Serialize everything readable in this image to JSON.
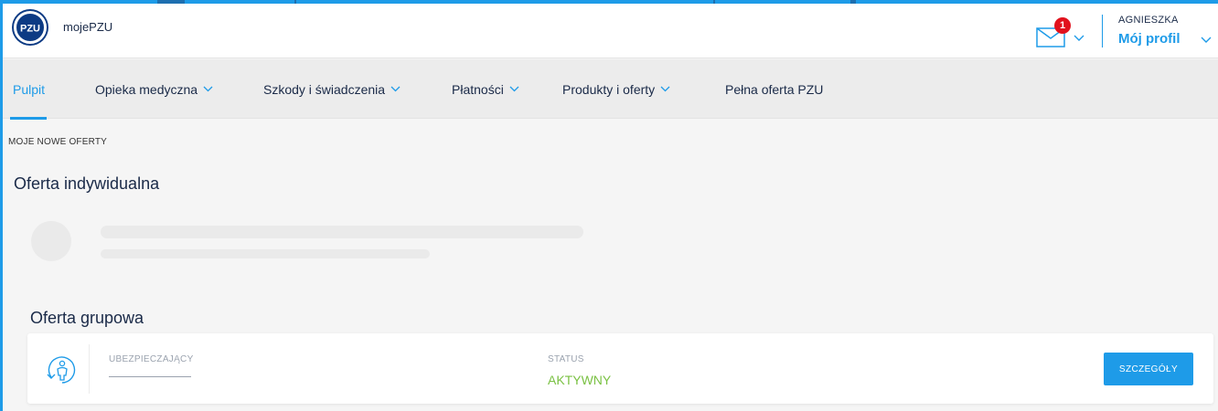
{
  "header": {
    "app_name": "mojePZU",
    "logo_text": "PZU",
    "notification_count": "1",
    "user_name": "AGNIESZKA",
    "profile_link": "Mój profil"
  },
  "nav": {
    "items": [
      {
        "label": "Pulpit",
        "active": true,
        "dropdown": false
      },
      {
        "label": "Opieka medyczna",
        "active": false,
        "dropdown": true
      },
      {
        "label": "Szkody i świadczenia",
        "active": false,
        "dropdown": true
      },
      {
        "label": "Płatności",
        "active": false,
        "dropdown": true
      },
      {
        "label": "Produkty i oferty",
        "active": false,
        "dropdown": true
      },
      {
        "label": "Pełna oferta PZU",
        "active": false,
        "dropdown": false
      }
    ]
  },
  "main": {
    "section_label": "MOJE NOWE OFERTY",
    "individual_title": "Oferta indywidualna",
    "group_title": "Oferta grupowa",
    "group_card": {
      "insurer_label": "UBEZPIECZAJĄCY",
      "status_label": "STATUS",
      "status_value": "AKTYWNY",
      "details_button": "SZCZEGÓŁY"
    }
  },
  "colors": {
    "accent": "#1e9be8",
    "brand_navy": "#0d3b84",
    "status_active": "#7ac143",
    "badge": "#e1121d"
  },
  "icons": [
    "pzu-logo",
    "mail-icon",
    "chevron-down-icon",
    "person-refresh-icon"
  ]
}
